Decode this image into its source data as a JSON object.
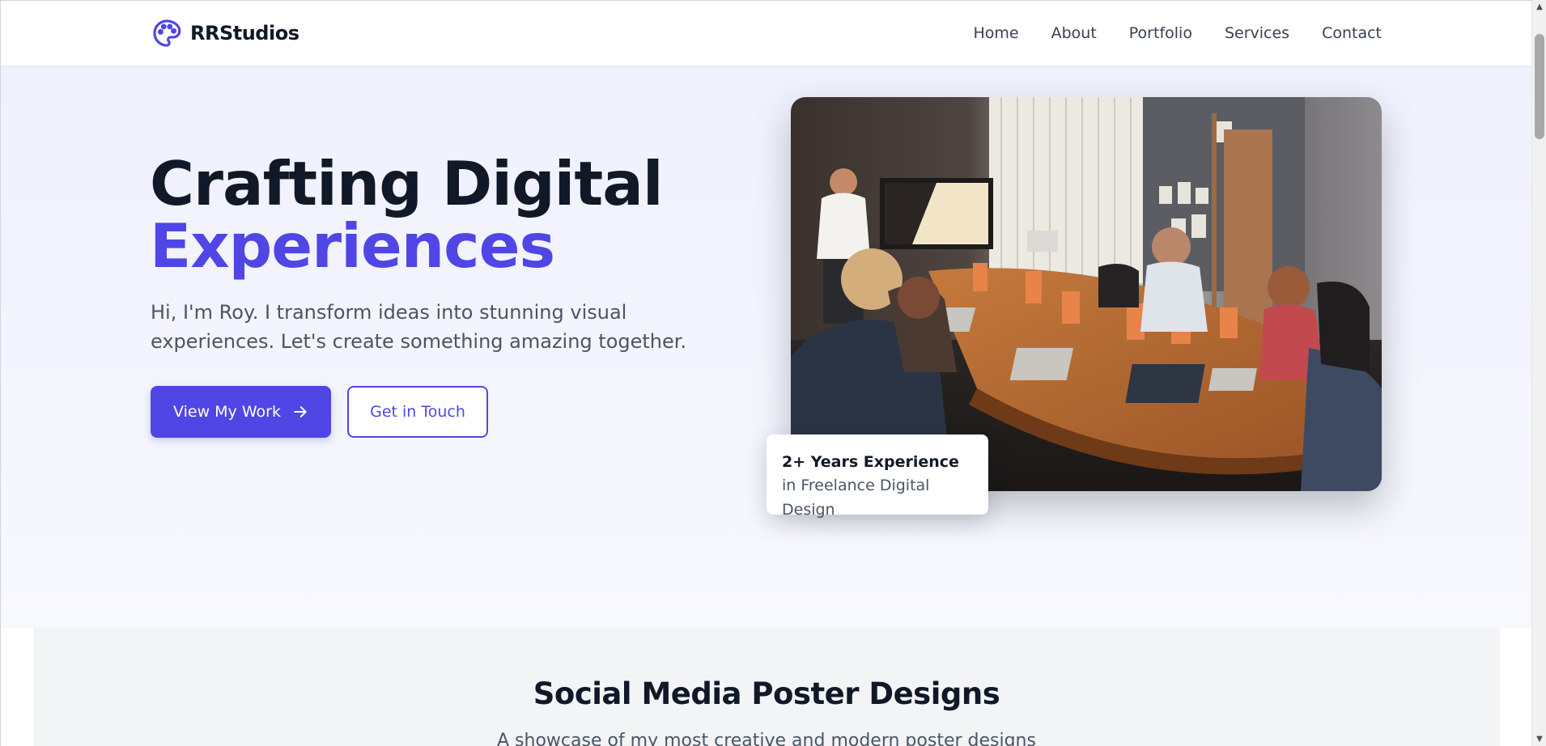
{
  "header": {
    "logo_icon": "palette-icon",
    "brand": "RRStudios",
    "nav": [
      {
        "label": "Home"
      },
      {
        "label": "About"
      },
      {
        "label": "Portfolio"
      },
      {
        "label": "Services"
      },
      {
        "label": "Contact"
      }
    ]
  },
  "hero": {
    "title_line1": "Crafting Digital",
    "title_line2": "Experiences",
    "subtitle": "Hi, I'm Roy. I transform ideas into stunning visual experiences. Let's create something amazing together.",
    "primary_button": "View My Work",
    "primary_button_icon": "arrow-right-icon",
    "secondary_button": "Get in Touch",
    "experience_card": {
      "title": "2+ Years Experience",
      "subtitle": "in Freelance Digital Design"
    }
  },
  "posters": {
    "title": "Social Media Poster Designs",
    "subtitle": "A showcase of my most creative and modern poster designs"
  },
  "colors": {
    "accent": "#4f46e5",
    "heading": "#111827",
    "body_text": "#4b5563",
    "hero_bg": "#eff1fd",
    "section_bg": "#f3f4f6"
  }
}
